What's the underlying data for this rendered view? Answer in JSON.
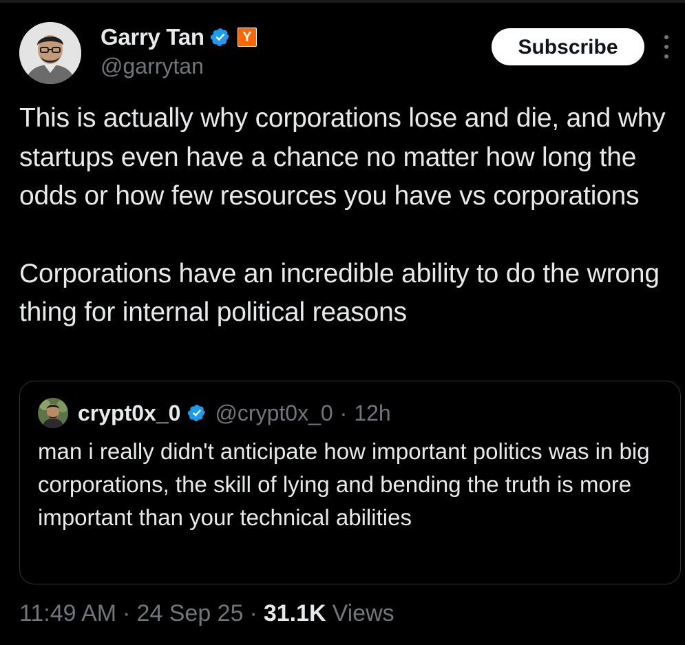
{
  "tweet": {
    "author": {
      "display_name": "Garry Tan",
      "handle": "@garrytan",
      "verified_icon": "verified-badge-icon",
      "affiliate_badge": "Y",
      "affiliate_color": "#ff6600"
    },
    "subscribe_label": "Subscribe",
    "paragraphs": [
      "This is actually why corporations lose and die, and why startups even have a chance no matter how long the odds or how few resources you have vs corporations",
      "Corporations have an incredible ability to do the wrong thing for internal political reasons"
    ],
    "quote": {
      "display_name": "crypt0x_0",
      "handle": "@crypt0x_0",
      "dot": "·",
      "time": "12h",
      "text": "man i really didn't anticipate how important politics was in big corporations, the skill of lying and bending the truth is more important than your technical abilities"
    },
    "meta": {
      "time": "11:49 AM",
      "dot": "·",
      "date": "24 Sep 25",
      "views_count": "31.1K",
      "views_label": "Views"
    }
  },
  "colors": {
    "background": "#000000",
    "text_primary": "#e7e9ea",
    "text_secondary": "#71767b",
    "verified_blue": "#1d9bf0",
    "border": "#2f3336"
  }
}
